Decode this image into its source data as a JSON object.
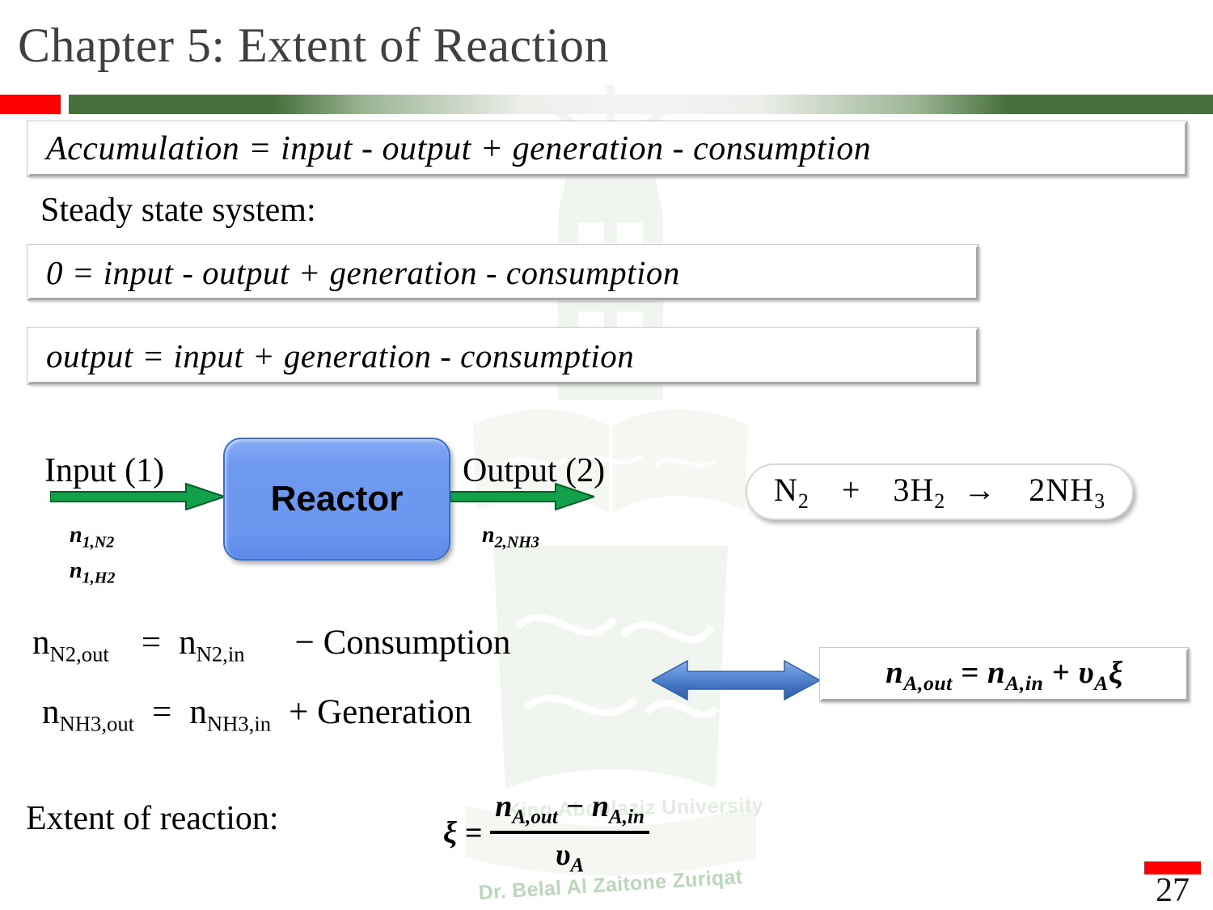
{
  "slide": {
    "title": "Chapter 5: Extent of  Reaction",
    "page_number": "27",
    "accent_red": "#ff0000",
    "accent_green": "#47703d",
    "reactor_blue": "#6e99f0",
    "arrow_green": "#12a04a",
    "arrow_blue": "#4a7ec9"
  },
  "watermark": {
    "university": "King Abdulaziz University",
    "author": "Dr. Belal Al Zaitone Zuriqat"
  },
  "equations": {
    "accumulation": "Accumulation  =   input   -   output   +   generation   -   consumption",
    "steady_label": "Steady state system:",
    "zero_balance": "0 =   input   -   output   +   generation   -   consumption",
    "output_balance": "output =   input   +   generation   -   consumption"
  },
  "diagram": {
    "input_label": "Input (1)",
    "output_label": "Output (2)",
    "reactor_label": "Reactor",
    "input_stream_1": "n",
    "input_stream_1_sub": "1,N2",
    "input_stream_2": "n",
    "input_stream_2_sub": "1,H2",
    "output_stream": "n",
    "output_stream_sub": "2,NH3",
    "reaction": {
      "reactant_1": "N",
      "reactant_1_sub": "2",
      "plus": "+",
      "reactant_2": "3H",
      "reactant_2_sub": "2",
      "arrow": "→",
      "product": "2NH",
      "product_sub": "3"
    }
  },
  "balances": {
    "n2": {
      "lhs": "n",
      "lhs_sub": "N2,out",
      "eq": "=",
      "rhs": "n",
      "rhs_sub": "N2,in",
      "term": "− Consumption"
    },
    "nh3": {
      "lhs": "n",
      "lhs_sub": "NH3,out",
      "eq": "=",
      "rhs": "n",
      "rhs_sub": "NH3,in",
      "term": "+ Generation"
    },
    "general": {
      "lhs": "n",
      "lhs_sub": "A,out",
      "eq": " = ",
      "rhs": "n",
      "rhs_sub": "A,in",
      "plus": " + ",
      "nu": "υ",
      "nu_sub": "A",
      "xi": "ξ"
    }
  },
  "extent": {
    "label": "Extent of  reaction:",
    "xi_eq": "ξ =",
    "numerator_first": "n",
    "numerator_first_sub": "A,out",
    "numerator_minus": " − ",
    "numerator_second": "n",
    "numerator_second_sub": "A,in",
    "denominator": "υ",
    "denominator_sub": "A"
  }
}
